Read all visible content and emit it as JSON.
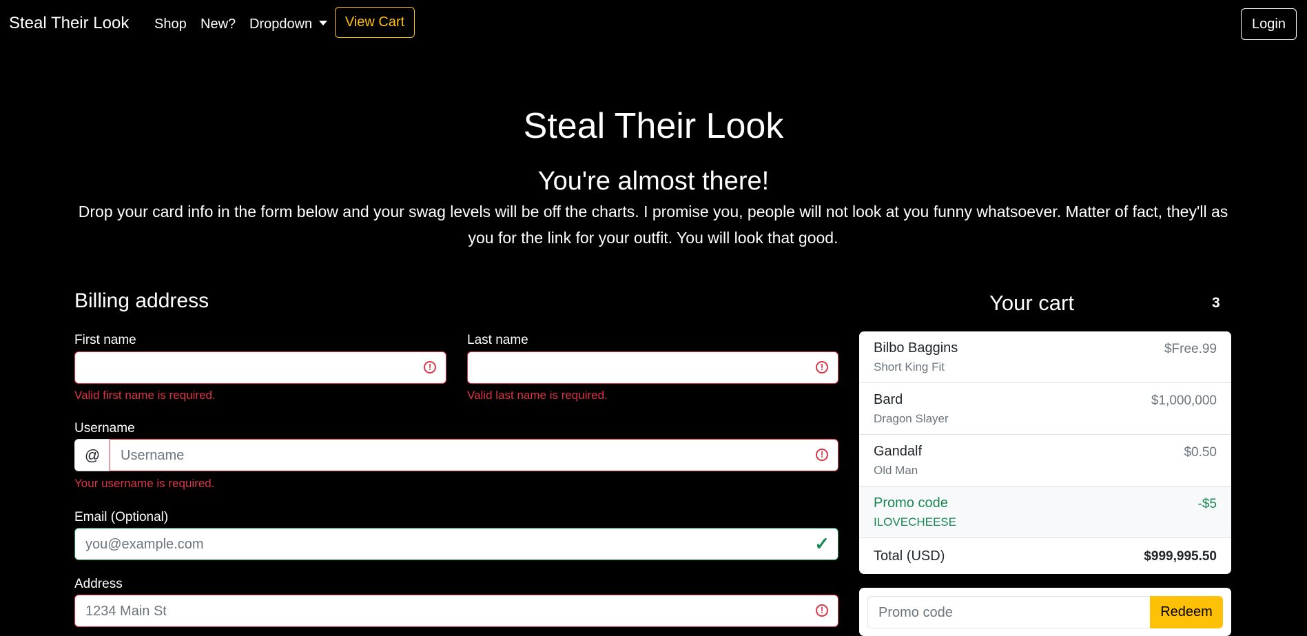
{
  "nav": {
    "brand": "Steal Their Look",
    "links": [
      "Shop",
      "New?",
      "Dropdown"
    ],
    "view_cart": "View Cart",
    "login": "Login"
  },
  "hero": {
    "title": "Steal Their Look",
    "subtitle": "You're almost there!",
    "text": "Drop your card info in the form below and your swag levels will be off the charts. I promise you, people will not look at you funny whatsoever. Matter of fact, they'll as you for the link for your outfit. You will look that good."
  },
  "form": {
    "title": "Billing address",
    "first_name": {
      "label": "First name",
      "value": "",
      "error": "Valid first name is required."
    },
    "last_name": {
      "label": "Last name",
      "value": "",
      "error": "Valid last name is required."
    },
    "username": {
      "label": "Username",
      "addon": "@",
      "placeholder": "Username",
      "error": "Your username is required."
    },
    "email": {
      "label": "Email (Optional)",
      "placeholder": "you@example.com"
    },
    "address": {
      "label": "Address",
      "placeholder": "1234 Main St"
    }
  },
  "cart": {
    "title": "Your cart",
    "count": "3",
    "items": [
      {
        "name": "Bilbo Baggins",
        "desc": "Short King Fit",
        "price": "$Free.99"
      },
      {
        "name": "Bard",
        "desc": "Dragon Slayer",
        "price": "$1,000,000"
      },
      {
        "name": "Gandalf",
        "desc": "Old Man",
        "price": "$0.50"
      }
    ],
    "promo": {
      "label": "Promo code",
      "code": "ILOVECHEESE",
      "amount": "-$5"
    },
    "total": {
      "label": "Total (USD)",
      "value": "$999,995.50"
    },
    "promo_input": {
      "placeholder": "Promo code",
      "button": "Redeem"
    }
  },
  "colors": {
    "accent": "#ffc107",
    "error": "#dc3545",
    "success": "#198754"
  }
}
